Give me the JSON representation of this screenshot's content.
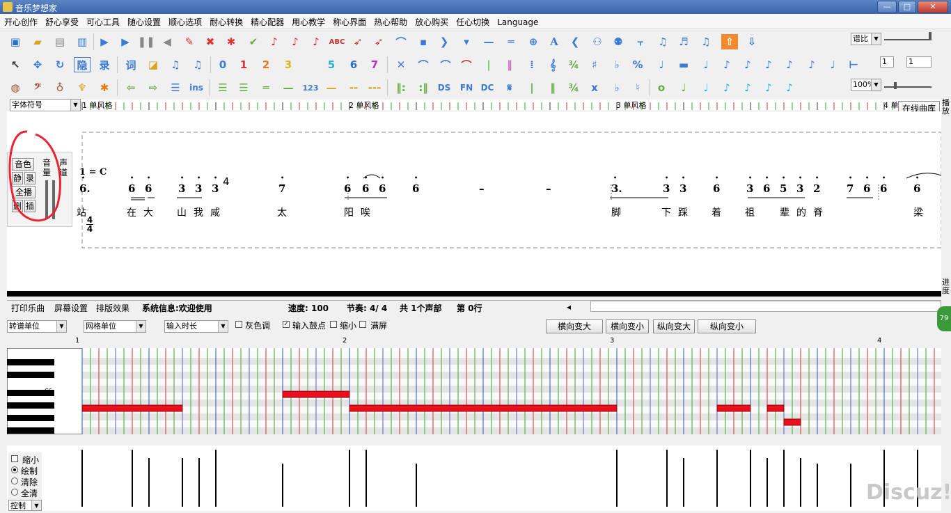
{
  "window": {
    "title": "音乐梦想家",
    "minimize": "—",
    "maximize": "□",
    "close": "✕"
  },
  "menu": [
    "开心创作",
    "舒心享受",
    "可心工具",
    "随心设置",
    "顺心选项",
    "耐心转换",
    "精心配器",
    "用心教学",
    "称心界面",
    "热心帮助",
    "放心购买",
    "任心切换",
    "Language"
  ],
  "right_panel": {
    "view_select": "谱比",
    "box1": "1",
    "box2": "1",
    "zoom_select": "100%"
  },
  "font_select": "字体符号",
  "ruler": {
    "marks": [
      {
        "num": "1",
        "label": "单风格"
      },
      {
        "num": "2",
        "label": "单风格"
      },
      {
        "num": "3",
        "label": "单风格"
      },
      {
        "num": "4",
        "label": "单"
      }
    ]
  },
  "online_library": "在线曲库",
  "side_tabs": {
    "top": "播放",
    "bottom": "进度"
  },
  "track_panel": {
    "timbre": "音色",
    "volume": "音量",
    "balance": "声道",
    "mute": "静",
    "record": "录",
    "play_all": "全播",
    "delete": "删",
    "insert": "插"
  },
  "score": {
    "key": "1 = C",
    "time_top": "4",
    "time_bottom": "4",
    "beat_mark": "4",
    "notes": [
      "6.",
      "6",
      "6",
      "3",
      "3",
      "3",
      "7",
      "6",
      "6",
      "6",
      "6",
      "–",
      "–",
      "3.",
      "3",
      "3",
      "6",
      "3",
      "6",
      "5",
      "3",
      "2",
      "7",
      "6",
      "6",
      "6"
    ],
    "lyrics": [
      "站",
      "在",
      "大",
      "山",
      "我",
      "咸",
      "太",
      "阳",
      "唉",
      "脚",
      "下",
      "踩",
      "着",
      "祖",
      "辈",
      "的",
      "脊",
      "梁"
    ]
  },
  "status": {
    "tabs": [
      "打印乐曲",
      "屏幕设置",
      "排版效果"
    ],
    "info": "系统信息:欢迎使用",
    "tempo": "速度: 100",
    "meter": "节奏: 4/ 4",
    "voices": "共 1个声部",
    "line": "第 0行"
  },
  "roll_controls": {
    "transpose": "转谱单位",
    "grid": "网格单位",
    "input_len": "输入时长",
    "gray": "灰色调",
    "gray_checked": false,
    "drum": "输入鼓点",
    "drum_checked": true,
    "shrink": "缩小",
    "shrink_checked": false,
    "full": "满屏",
    "full_checked": false,
    "btns": [
      "横向变大",
      "横向变小",
      "纵向变大",
      "纵向变小"
    ],
    "badge": "79"
  },
  "roll": {
    "bars": [
      "1",
      "2",
      "3",
      "4"
    ],
    "c_label": "C6"
  },
  "velocity_panel": {
    "shrink": "缩小",
    "draw": "绘制",
    "clear": "清除",
    "clear_all": "全清",
    "mode": "控制",
    "selected": "绘制"
  },
  "watermark": "Discuz!"
}
